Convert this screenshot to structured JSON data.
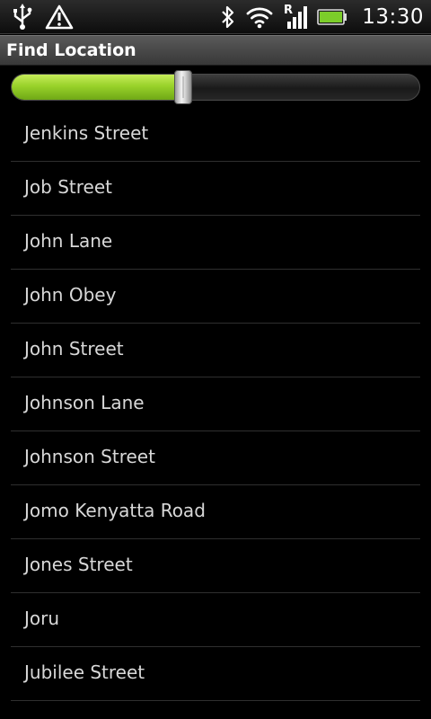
{
  "status_bar": {
    "time": "13:30",
    "roaming_indicator": "R",
    "battery_color": "#7ccd2a",
    "icons": [
      "usb-icon",
      "warning-icon",
      "bluetooth-icon",
      "wifi-icon",
      "signal-icon",
      "battery-icon"
    ]
  },
  "header": {
    "title": "Find Location"
  },
  "slider": {
    "value_percent": 42,
    "fill_color": "#99d22a"
  },
  "locations": [
    "Jenkins Street",
    "Job Street",
    "John Lane",
    "John Obey",
    "John Street",
    "Johnson Lane",
    "Johnson Street",
    "Jomo Kenyatta Road",
    "Jones Street",
    "Joru",
    "Jubilee Street"
  ]
}
